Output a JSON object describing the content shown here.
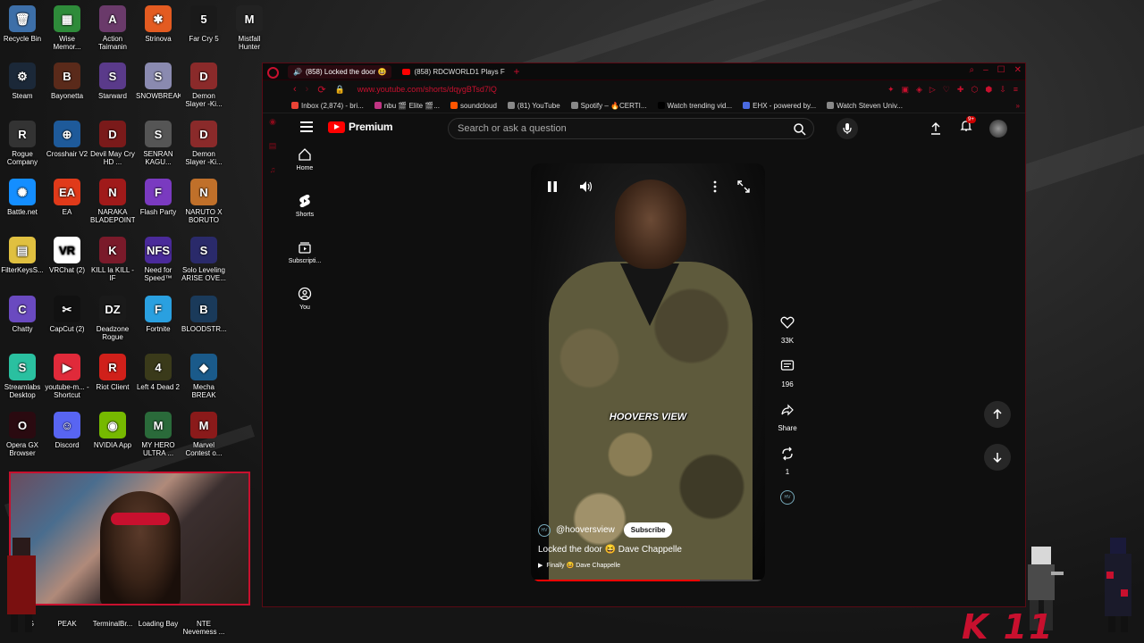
{
  "desktop_icons": [
    {
      "label": "Recycle Bin",
      "color": "#3d6fa8",
      "glyph": "🗑"
    },
    {
      "label": "Wise Memor...",
      "color": "#2e8b3a",
      "glyph": "▦"
    },
    {
      "label": "Action Taimanin",
      "color": "#6a3a6a",
      "glyph": "A"
    },
    {
      "label": "Strinova",
      "color": "#e35b21",
      "glyph": "✱"
    },
    {
      "label": "Far Cry 5",
      "color": "#1a1a1a",
      "glyph": "5"
    },
    {
      "label": "Mistfall Hunter",
      "color": "#222222",
      "glyph": "M"
    },
    {
      "label": "Steam",
      "color": "#1b2838",
      "glyph": "⚙"
    },
    {
      "label": "Bayonetta",
      "color": "#5a2a1a",
      "glyph": "B"
    },
    {
      "label": "Starward",
      "color": "#5a3a8a",
      "glyph": "S"
    },
    {
      "label": "SNOWBREAK",
      "color": "#8a8ab0",
      "glyph": "S"
    },
    {
      "label": "Demon Slayer -Ki...",
      "color": "#8a2a2a",
      "glyph": "D"
    },
    {
      "label": "Rogue Company",
      "color": "#333333",
      "glyph": "R"
    },
    {
      "label": "Crosshair V2",
      "color": "#1e5a9a",
      "glyph": "⊕"
    },
    {
      "label": "Devil May Cry HD ...",
      "color": "#7a1a1a",
      "glyph": "D"
    },
    {
      "label": "SENRAN KAGU...",
      "color": "#555555",
      "glyph": "S"
    },
    {
      "label": "Demon Slayer -Ki...",
      "color": "#8a2a2a",
      "glyph": "D"
    },
    {
      "label": "Battle.net",
      "color": "#148eff",
      "glyph": "✺"
    },
    {
      "label": "EA",
      "color": "#e03a1a",
      "glyph": "EA"
    },
    {
      "label": "NARAKA BLADEPOINT",
      "color": "#a01a1a",
      "glyph": "N"
    },
    {
      "label": "Flash Party",
      "color": "#7a3ac0",
      "glyph": "F"
    },
    {
      "label": "NARUTO X BORUTO UL...",
      "color": "#c0702a",
      "glyph": "N"
    },
    {
      "label": "FilterKeysS...",
      "color": "#e0c040",
      "glyph": "▤"
    },
    {
      "label": "VRChat (2)",
      "color": "#ffffff",
      "glyph": "VR"
    },
    {
      "label": "KILL la KILL -IF",
      "color": "#7a1a2a",
      "glyph": "K"
    },
    {
      "label": "Need for Speed™ Heat",
      "color": "#4a2a9a",
      "glyph": "NFS"
    },
    {
      "label": "Solo Leveling ARISE OVE...",
      "color": "#2a2a6a",
      "glyph": "S"
    },
    {
      "label": "Chatty",
      "color": "#6a4ac0",
      "glyph": "C"
    },
    {
      "label": "CapCut (2)",
      "color": "#111111",
      "glyph": "✂"
    },
    {
      "label": "Deadzone Rogue",
      "color": "#1a1a1a",
      "glyph": "DZ"
    },
    {
      "label": "Fortnite",
      "color": "#2aa0e0",
      "glyph": "F"
    },
    {
      "label": "BLOODSTR...",
      "color": "#1a3a5a",
      "glyph": "B"
    },
    {
      "label": "Streamlabs Desktop",
      "color": "#2ac0a0",
      "glyph": "S"
    },
    {
      "label": "youtube-m... - Shortcut",
      "color": "#e02a3a",
      "glyph": "▶"
    },
    {
      "label": "Riot Client",
      "color": "#d0201a",
      "glyph": "R"
    },
    {
      "label": "Left 4 Dead 2",
      "color": "#3a3a1a",
      "glyph": "4"
    },
    {
      "label": "Mecha BREAK",
      "color": "#1a5a8a",
      "glyph": "◆"
    },
    {
      "label": "Opera GX Browser",
      "color": "#2a0a10",
      "glyph": "O"
    },
    {
      "label": "Discord",
      "color": "#5865f2",
      "glyph": "☺"
    },
    {
      "label": "NVIDIA App",
      "color": "#76b900",
      "glyph": "◉"
    },
    {
      "label": "MY HERO ULTRA ...",
      "color": "#2a6a3a",
      "glyph": "M"
    },
    {
      "label": "Marvel Contest o...",
      "color": "#8a1a1a",
      "glyph": "M"
    }
  ],
  "taskbar_icons": [
    {
      "label": "G",
      "x_label": ""
    },
    {
      "label": "PEAK"
    },
    {
      "label": "TerminalBr..."
    },
    {
      "label": "Loading Bay"
    },
    {
      "label": "NTE Nevemess ..."
    }
  ],
  "browser": {
    "tabs": [
      {
        "label": "(858) Locked the door 😆",
        "active": true
      },
      {
        "label": "(858) RDCWORLD1 Plays F",
        "active": false
      }
    ],
    "url": "www.youtube.com/shorts/dqygBTsd7lQ",
    "bookmarks": [
      {
        "label": "Inbox (2,874) - bri...",
        "color": "#ea4335"
      },
      {
        "label": "nbu 🎬 Elite 🎬...",
        "color": "#c13584"
      },
      {
        "label": "soundcloud",
        "color": "#ff5500"
      },
      {
        "label": "(81) YouTube",
        "color": "#888888"
      },
      {
        "label": "Spotify – 🔥CERTI...",
        "color": "#888888"
      },
      {
        "label": "Watch trending vid...",
        "color": "#000000"
      },
      {
        "label": "EHX - powered by...",
        "color": "#4a6ae0"
      },
      {
        "label": "Watch Steven Univ...",
        "color": "#888888"
      }
    ]
  },
  "youtube": {
    "logo_text": "Premium",
    "search_placeholder": "Search or ask a question",
    "notif_badge": "9+",
    "nav": [
      {
        "label": "Home",
        "icon": "home-icon"
      },
      {
        "label": "Shorts",
        "icon": "shorts-icon"
      },
      {
        "label": "Subscripti...",
        "icon": "subscriptions-icon"
      },
      {
        "label": "You",
        "icon": "you-icon"
      }
    ],
    "short": {
      "caption": "HOOVERS VIEW",
      "channel": "@hooversview",
      "channel_avatar": "HV",
      "subscribe_label": "Subscribe",
      "title": "Locked the door 😆 Dave Chappelle",
      "music": "Finally 😆 Dave Chappelle",
      "progress": 0.72
    },
    "actions": {
      "likes": "33K",
      "comments": "196",
      "share": "Share",
      "remix": "1"
    }
  },
  "overlay": {
    "logo_text": "K 11"
  }
}
